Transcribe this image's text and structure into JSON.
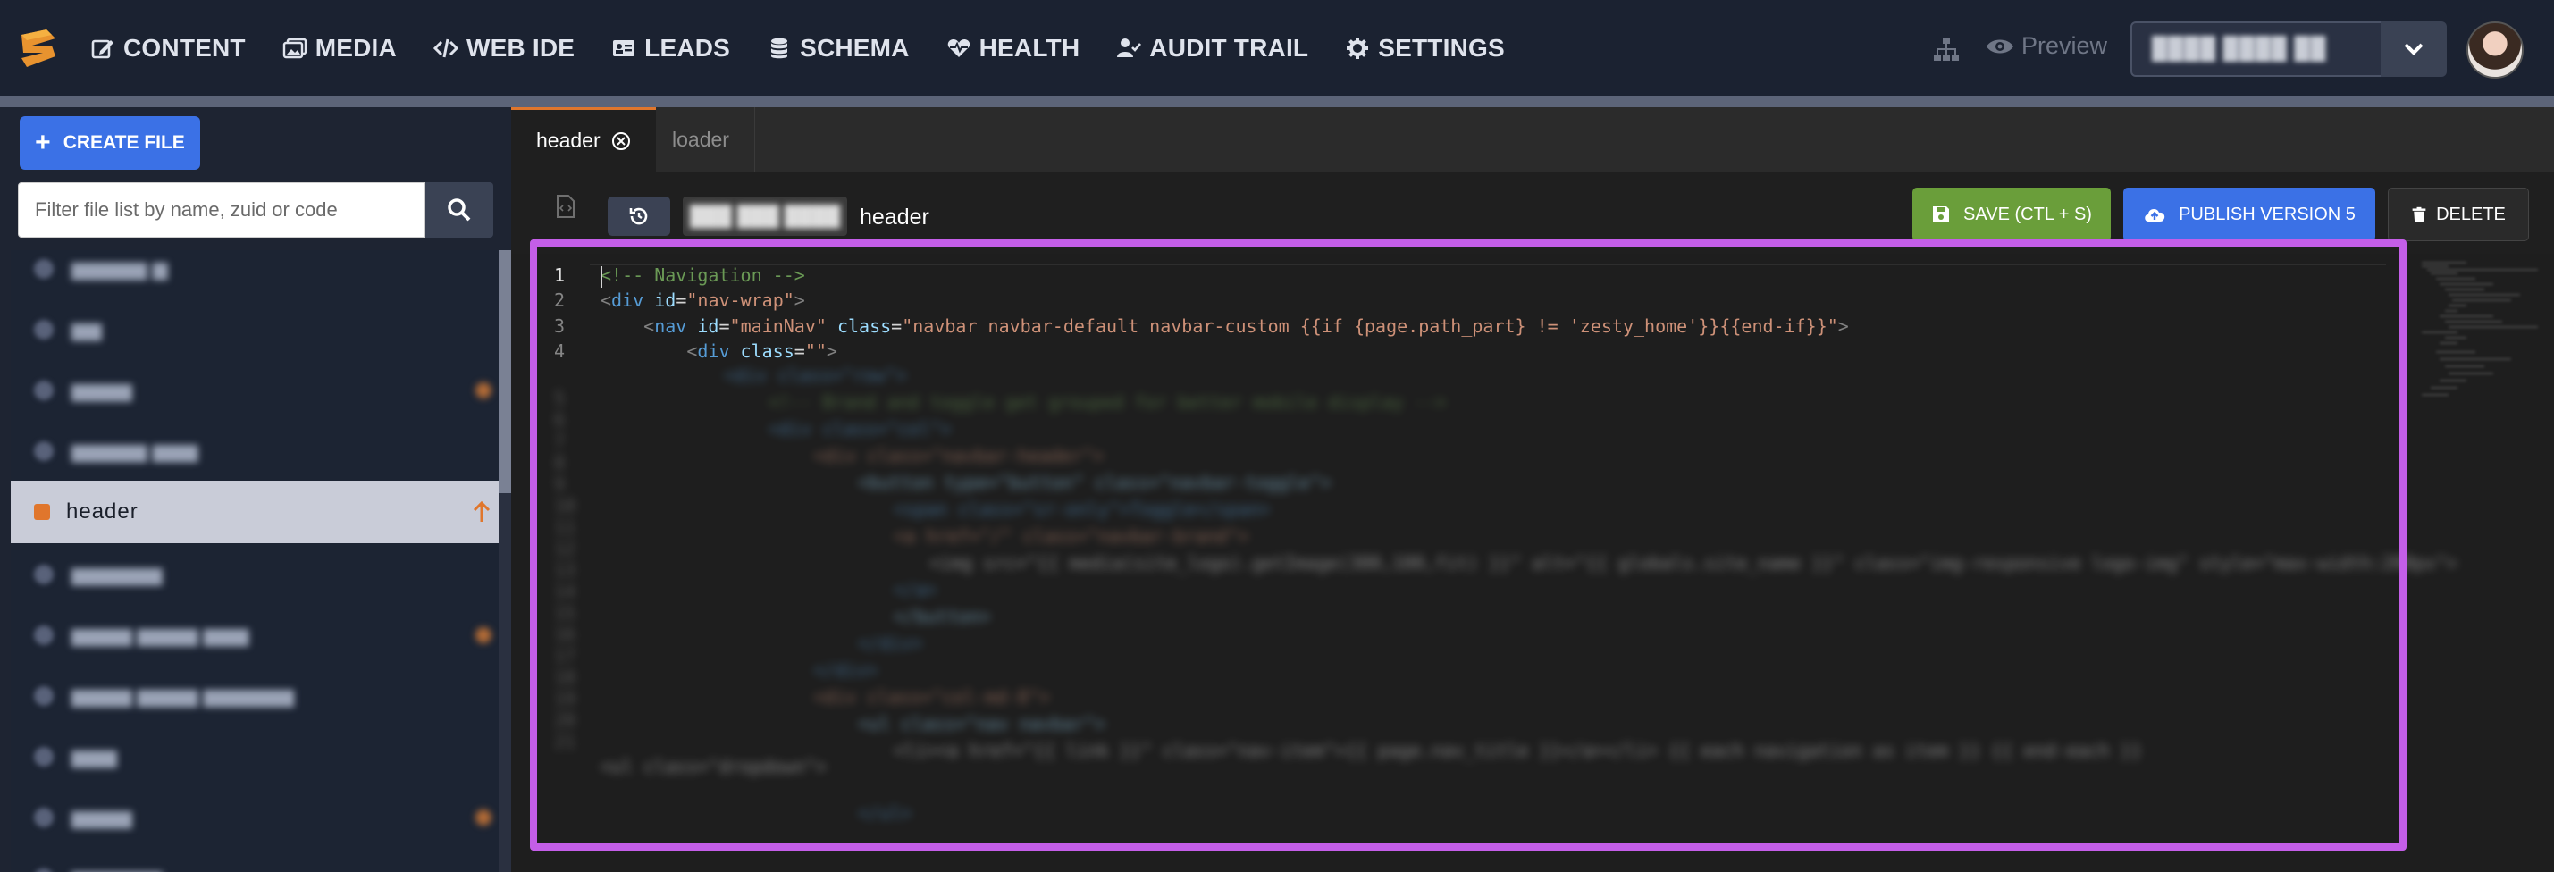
{
  "nav": {
    "items": [
      {
        "label": "CONTENT",
        "icon": "edit-icon"
      },
      {
        "label": "MEDIA",
        "icon": "images-icon"
      },
      {
        "label": "WEB IDE",
        "icon": "code-icon"
      },
      {
        "label": "LEADS",
        "icon": "id-card-icon"
      },
      {
        "label": "SCHEMA",
        "icon": "database-icon"
      },
      {
        "label": "HEALTH",
        "icon": "heartbeat-icon"
      },
      {
        "label": "AUDIT TRAIL",
        "icon": "user-check-icon"
      },
      {
        "label": "SETTINGS",
        "icon": "gear-icon"
      }
    ],
    "preview_label": "Preview",
    "instance_name": "████ ████ ██"
  },
  "sidebar": {
    "create_label": "CREATE FILE",
    "filter_placeholder": "Filter file list by name, zuid or code",
    "active_file": "header"
  },
  "editor": {
    "tabs": [
      {
        "label": "header",
        "active": true
      },
      {
        "label": "loader",
        "active": false
      }
    ],
    "zuid": "███ ███ ████",
    "filename": "header",
    "save_label": "SAVE (CTL + S)",
    "publish_label": "PUBLISH VERSION 5",
    "delete_label": "DELETE",
    "line_numbers": [
      "1",
      "2",
      "3",
      "4"
    ]
  },
  "colors": {
    "accent": "#e0762c",
    "primary": "#3b71e6",
    "save": "#6a9e3a",
    "highlight": "#c45ee8"
  }
}
